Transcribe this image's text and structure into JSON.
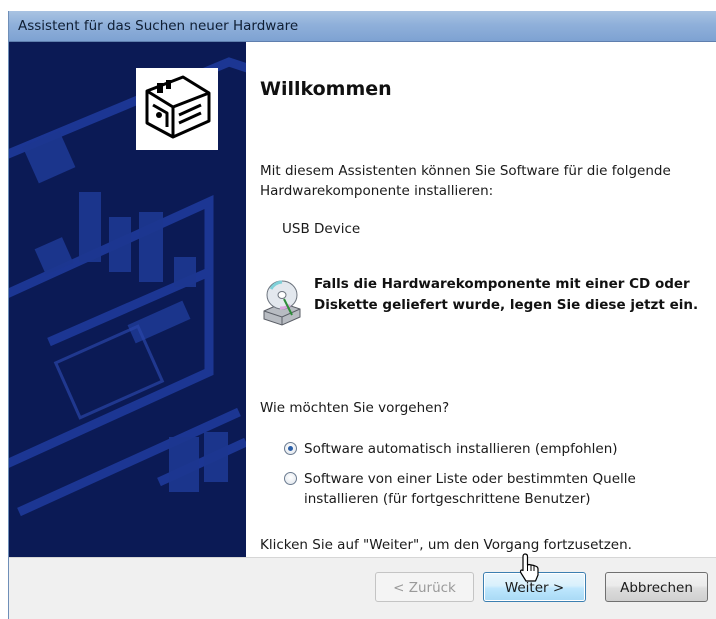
{
  "window": {
    "title": "Assistent für das Suchen neuer Hardware"
  },
  "side_panel": {
    "icon": "hardware-card-icon",
    "background_color": "#0b1a55"
  },
  "content": {
    "heading": "Willkommen",
    "intro": "Mit diesem Assistenten können Sie Software für die folgende Hardwarekomponente installieren:",
    "device_name": "USB Device",
    "cd_notice": "Falls die Hardwarekomponente mit einer CD oder Diskette geliefert wurde, legen Sie diese jetzt ein.",
    "cd_icon": "cd-drive-icon",
    "question": "Wie möchten Sie vorgehen?",
    "options": [
      {
        "label": "Software automatisch installieren (empfohlen)",
        "selected": true
      },
      {
        "label": "Software von einer Liste oder bestimmten Quelle installieren (für fortgeschrittene Benutzer)",
        "selected": false
      }
    ],
    "continue_hint": "Klicken Sie auf \"Weiter\", um den Vorgang fortzusetzen."
  },
  "footer": {
    "back_label": "< Zurück",
    "next_label": "Weiter >",
    "cancel_label": "Abbrechen"
  },
  "colors": {
    "titlebar": "#8fb0da",
    "accent": "#3c7fb1",
    "panel": "#0b1a55"
  }
}
